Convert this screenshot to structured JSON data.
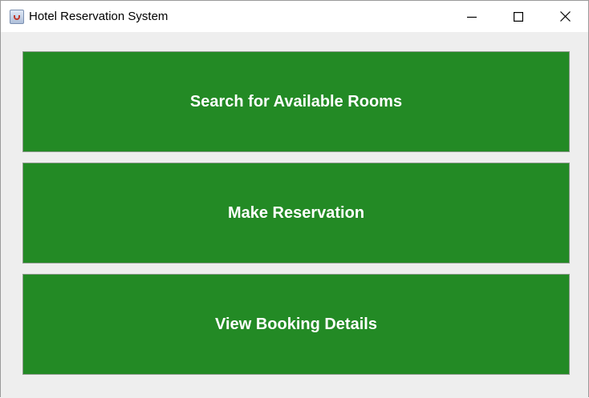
{
  "window": {
    "title": "Hotel Reservation System",
    "icon": "java-cup-icon"
  },
  "controls": {
    "minimize": "minimize-icon",
    "maximize": "maximize-icon",
    "close": "close-icon"
  },
  "buttons": [
    {
      "label": "Search for Available Rooms"
    },
    {
      "label": "Make Reservation"
    },
    {
      "label": "View Booking Details"
    }
  ],
  "colors": {
    "button_bg": "#238a25",
    "button_text": "#ffffff",
    "window_bg": "#eeeeee"
  }
}
